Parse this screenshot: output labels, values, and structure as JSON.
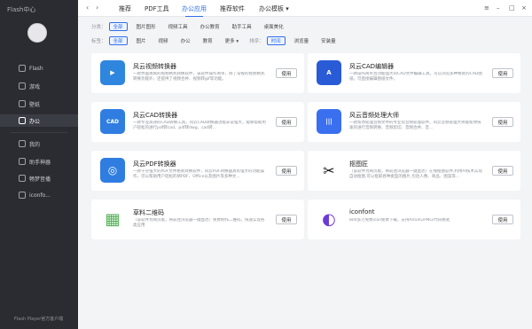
{
  "sidebar": {
    "app_title": "Flash中心",
    "items": [
      {
        "label": "Flash",
        "icon": "play-icon"
      },
      {
        "label": "游戏",
        "icon": "gamepad-icon"
      },
      {
        "label": "壁纸",
        "icon": "image-icon"
      },
      {
        "label": "办公",
        "icon": "briefcase-icon"
      },
      {
        "label": "我的",
        "icon": "user-icon"
      },
      {
        "label": "助手神器",
        "icon": "robot-icon"
      },
      {
        "label": "畅梦音播",
        "icon": "music-icon"
      },
      {
        "label": "iconfo...",
        "icon": "palette-icon"
      }
    ],
    "footer": "Flash Player官方客户端"
  },
  "topbar": {
    "tabs": [
      "推荐",
      "PDF工具",
      "办公应用",
      "推荐软件",
      "办公模板 ▾"
    ],
    "active_tab": "办公应用"
  },
  "filters": {
    "category_label": "分类：",
    "categories": [
      "全部",
      "图片图形",
      "视频工具",
      "办公教育",
      "助手工具",
      "桌面美化"
    ],
    "tag_label": "标签：",
    "tags": [
      "全部",
      "图片",
      "视频",
      "办公",
      "教育",
      "更多 ▾"
    ],
    "sort_label": "排序：",
    "sorts": [
      "时间",
      "浏览量",
      "安装量"
    ]
  },
  "cards": [
    {
      "title": "风云视频转换器",
      "desc": "一款界面清爽的视频格式转换软件，该软件操作简单，除了常规的视频格式转换功能外，还提供了视频合并、视频转gif等功能。",
      "use": "使用",
      "icon_color": "#2e86de",
      "icon_text": "▶"
    },
    {
      "title": "风云CAD编辑器",
      "desc": "一款操作简单且功能强大的CAD文件编辑工具，可以浏览多种格式的CAD图纸，可直接编辑图纸文件。",
      "use": "使用",
      "icon_color": "#2a5bd7",
      "icon_text": "A"
    },
    {
      "title": "风云CAD转换器",
      "desc": "一款专业高效的CAD转换工具，风云CAD转换器功能非常强大，能够帮助用户轻松的进行pdf转cad、pdf转dwg、cad转...",
      "use": "使用",
      "icon_color": "#2f7de1",
      "icon_text": "CAD"
    },
    {
      "title": "风云音频处理大师",
      "desc": "一款帮你处理音频文件的专业化音频处理软件，风云音频处理大师能帮你快速的进行音频转换、音频剪切、音频合并、音...",
      "use": "使用",
      "icon_color": "#3a6ff0",
      "icon_text": "|||"
    },
    {
      "title": "风云PDF转换器",
      "desc": "一款十分强大的PDF文件格式转换软件，风云PDF转换器具有强大的功能操作，可以帮助用户轻松的将PDF、Office以及图片等多种文...",
      "use": "使用",
      "icon_color": "#2f7de1",
      "icon_text": "◎"
    },
    {
      "title": "抠图匠",
      "desc": "（该软件为网页版，将前往浏览器一键直达）在线抠图软件,利用AI技术实现自动抠图,可以抠取各种类型的图片,包括人像、商品、图案等...",
      "use": "使用",
      "icon_color": "#ffffff",
      "icon_text": "✂"
    },
    {
      "title": "草料二维码",
      "desc": "（该软件为网页版，将前往浏览器一键直达）免费制作二维码，快速实现各类应用",
      "use": "使用",
      "icon_color": "#ffffff",
      "icon_text": "▦"
    },
    {
      "title": "iconfont",
      "desc": "800多万免费icon免费下载，支持AI/SVG/PNG/代码格式",
      "use": "使用",
      "icon_color": "#ffffff",
      "icon_text": "◐"
    }
  ]
}
